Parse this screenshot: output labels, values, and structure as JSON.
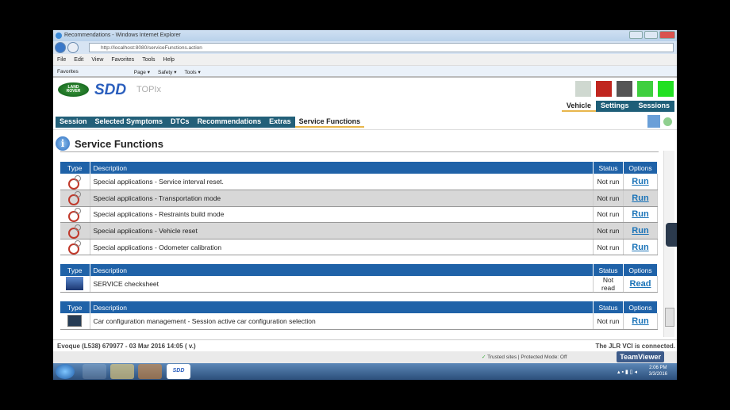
{
  "window": {
    "title": "Recommendations - Windows Internet Explorer",
    "url": "http://localhost:8080/serviceFunctions.action"
  },
  "menu": [
    "File",
    "Edit",
    "View",
    "Favorites",
    "Tools",
    "Help"
  ],
  "favbar": [
    "Favorites",
    "Page ▾",
    "Safety ▾",
    "Tools ▾"
  ],
  "app": {
    "logo": "LAND ROVER",
    "brand": "SDD",
    "product": "TOPIx",
    "header_tabs": [
      "Vehicle",
      "Settings",
      "Sessions"
    ],
    "nav": [
      "Session",
      "Selected Symptoms",
      "DTCs",
      "Recommendations",
      "Extras",
      "Service Functions"
    ],
    "section_title": "Service Functions"
  },
  "table_headers": {
    "type": "Type",
    "description": "Description",
    "status": "Status",
    "options": "Options"
  },
  "tables": [
    {
      "rows": [
        {
          "description": "Special applications - Service interval reset.",
          "status": "Not run",
          "option": "Run"
        },
        {
          "description": "Special applications - Transportation mode",
          "status": "Not run",
          "option": "Run"
        },
        {
          "description": "Special applications - Restraints build mode",
          "status": "Not run",
          "option": "Run"
        },
        {
          "description": "Special applications - Vehicle reset",
          "status": "Not run",
          "option": "Run"
        },
        {
          "description": "Special applications - Odometer calibration",
          "status": "Not run",
          "option": "Run"
        }
      ]
    },
    {
      "rows": [
        {
          "description": "SERVICE checksheet",
          "status": "Not read",
          "option": "Read"
        }
      ]
    },
    {
      "rows": [
        {
          "description": "Car configuration management - Session active car configuration selection",
          "status": "Not run",
          "option": "Run"
        }
      ]
    }
  ],
  "footer": {
    "vehicle": "Evoque (L538) 679977 - 03 Mar 2016 14:05 ( v.)",
    "vci": "The JLR VCI is connected."
  },
  "iestatus": {
    "zone": "Trusted sites | Protected Mode: Off",
    "teamviewer": "TeamViewer"
  },
  "taskbar": {
    "sdd": "SDD",
    "time": "2:06 PM",
    "date": "3/3/2016"
  }
}
